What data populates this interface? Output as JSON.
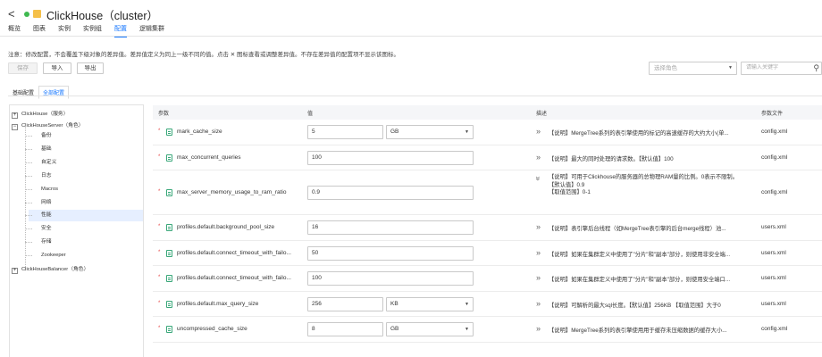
{
  "header": {
    "back_glyph": "<",
    "title": "ClickHouse（cluster）",
    "tabs": [
      {
        "label": "概览",
        "active": false
      },
      {
        "label": "图表",
        "active": false
      },
      {
        "label": "实例",
        "active": false
      },
      {
        "label": "实例组",
        "active": false
      },
      {
        "label": "配置",
        "active": true
      },
      {
        "label": "逻辑集群",
        "active": false
      }
    ]
  },
  "notice": "注意：修改配置，不会覆盖下级对象的差异值。差异值定义为同上一级不同的值。点击 ✕ 图标查看或调整差异值。不存在差异值的配置项不显示该图标。",
  "toolbar": {
    "save_label": "保存",
    "import_label": "导入",
    "export_label": "导出",
    "role_placeholder": "选择角色",
    "search_placeholder": "请输入关键字"
  },
  "subtabs": [
    {
      "label": "基础配置",
      "active": false
    },
    {
      "label": "全部配置",
      "active": true
    }
  ],
  "tree": {
    "root_service": "ClickHouse（服务）",
    "server_role": "ClickHouseServer（角色）",
    "server_children": [
      "备份",
      "基础",
      "自定义",
      "日志",
      "Macros",
      "网络",
      "性能",
      "安全",
      "存储",
      "Zookeeper"
    ],
    "selected_child": "性能",
    "balancer_role": "ClickHouseBalancer（角色）"
  },
  "table": {
    "headers": {
      "param": "参数",
      "value": "值",
      "desc": "描述",
      "file": "参数文件"
    },
    "rows": [
      {
        "name": "mark_cache_size",
        "value": "5",
        "unit": "GB",
        "desc": "【说明】MergeTree系列的表引擎使用的标记的高速缓存的大约大小(单...",
        "file": "config.xml"
      },
      {
        "name": "max_concurrent_queries",
        "value": "100",
        "unit": "",
        "desc": "【说明】最大的同时处理的请求数。【默认值】100",
        "file": "config.xml"
      },
      {
        "name": "max_server_memory_usage_to_ram_ratio",
        "value": "0.9",
        "unit": "",
        "desc_lines": [
          "【说明】可用于Clickhouse的服务器的总物理RAM量的比例。0表示不限制。",
          "【默认值】0.9",
          "【取值范围】0-1"
        ],
        "file": "config.xml"
      },
      {
        "name": "profiles.default.background_pool_size",
        "value": "16",
        "unit": "",
        "desc": "【说明】表引擎后台线程（如MergeTree表引擎的后台merge线程）池...",
        "file": "users.xml"
      },
      {
        "name": "profiles.default.connect_timeout_with_failo...",
        "value": "50",
        "unit": "",
        "desc": "【说明】如果在集群定义中使用了\"分片\"和\"副本\"部分，则使用非安全端...",
        "file": "users.xml"
      },
      {
        "name": "profiles.default.connect_timeout_with_failo...",
        "value": "100",
        "unit": "",
        "desc": "【说明】如果在集群定义中使用了\"分片\"和\"副本\"部分，则使用安全端口...",
        "file": "users.xml"
      },
      {
        "name": "profiles.default.max_query_size",
        "value": "256",
        "unit": "KB",
        "desc": "【说明】可解析的最大sql长度。【默认值】256KB 【取值范围】大于0",
        "file": "users.xml"
      },
      {
        "name": "uncompressed_cache_size",
        "value": "8",
        "unit": "GB",
        "desc": "【说明】MergeTree系列的表引擎使用用于缓存未压缩数据的缓存大小...",
        "file": "config.xml"
      }
    ]
  },
  "icons": {
    "expand": "chevrons-right-icon",
    "collapse": "chevrons-down-icon",
    "search": "search-icon",
    "required_marker": "*"
  },
  "colors": {
    "accent": "#1476ff",
    "status_ok": "#3fb950",
    "required": "#e64545"
  }
}
